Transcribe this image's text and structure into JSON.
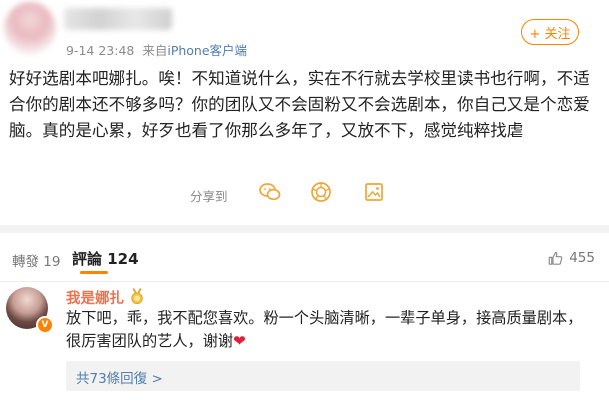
{
  "post": {
    "timestamp": "9-14 23:48",
    "source_prefix": "来自",
    "source": "iPhone客户端",
    "follow_label": "+ 关注",
    "text": "好好选剧本吧娜扎。唉！不知道说什么，实在不行就去学校里读书也行啊，不适合你的剧本还不够多吗？你的团队又不会固粉又不会选剧本，你自己又是个恋爱脑。真的是心累，好歹也看了你那么多年了，又放不下，感觉纯粹找虐",
    "share_label": "分享到"
  },
  "tabs": {
    "forward_label": "轉發",
    "forward_count": "19",
    "comments_label": "評論",
    "comments_count": "124",
    "likes_count": "455"
  },
  "comment": {
    "username": "我是娜扎",
    "text": "放下吧，乖，我不配您喜欢。粉一个头脑清晰，一辈子单身，接高质量剧本，很厉害团队的艺人，谢谢",
    "heart": "❤",
    "replies_label": "共73條回復 >"
  },
  "icons": [
    "wechat-icon",
    "moments-icon",
    "save-image-icon",
    "like-icon",
    "medal-icon",
    "verified-badge-icon"
  ],
  "colors": {
    "accent": "#ff8200",
    "link": "#507daf",
    "username": "#eb7350",
    "heart": "#e0203a"
  }
}
